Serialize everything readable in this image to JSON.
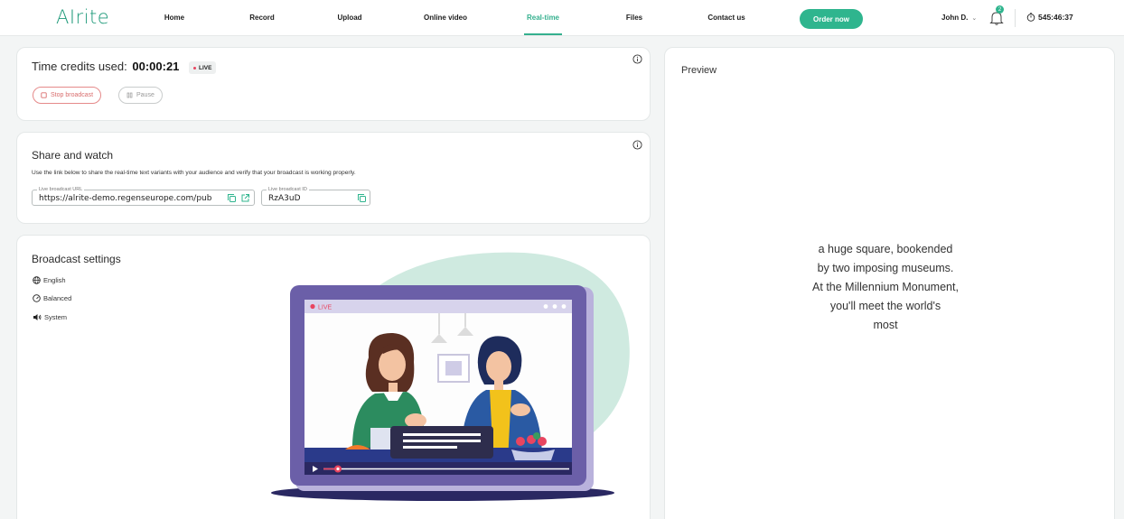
{
  "app": {
    "logo": "AIrite"
  },
  "nav": {
    "items": [
      {
        "label": "Home"
      },
      {
        "label": "Record"
      },
      {
        "label": "Upload"
      },
      {
        "label": "Online video"
      },
      {
        "label": "Real-time",
        "active": true
      },
      {
        "label": "Files"
      },
      {
        "label": "Contact us"
      }
    ],
    "order_label": "Order now",
    "user_name": "John D.",
    "notifications": "2",
    "time_balance": "545:46:37"
  },
  "broadcast": {
    "credits_label": "Time credits used:",
    "credits_value": "00:00:21",
    "live_label": "LIVE",
    "stop_label": "Stop broadcast",
    "pause_label": "Pause"
  },
  "share": {
    "title": "Share and watch",
    "description": "Use the link below to share the real-time text variants with your audience and verify that your broadcast is working properly.",
    "url_label": "Live broadcast URL",
    "url_value": "https://alrite-demo.regenseurope.com/pub",
    "id_label": "Live broadcast ID",
    "id_value": "RzA3uD"
  },
  "settings": {
    "title": "Broadcast settings",
    "language": "English",
    "mode": "Balanced",
    "audio": "System",
    "illustration_live": "LIVE"
  },
  "preview": {
    "title": "Preview",
    "lines": [
      "a huge square, bookended",
      "by two imposing museums.",
      "At the Millennium Monument,",
      "you'll meet the world's",
      "most"
    ]
  },
  "colors": {
    "accent": "#2fb58e",
    "live": "#e84560",
    "stop": "#d96d6d",
    "illustration_frame": "#6b5fa8",
    "blob": "#cfeae0"
  }
}
